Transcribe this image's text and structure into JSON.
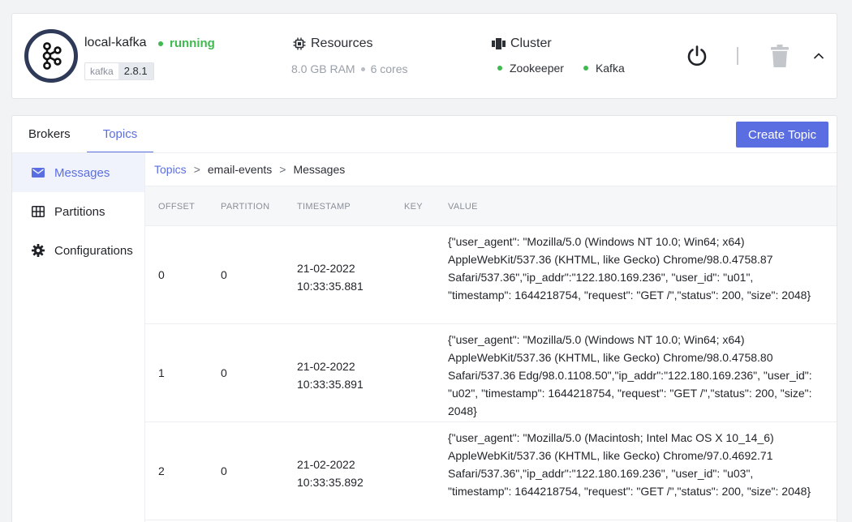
{
  "instance": {
    "name": "local-kafka",
    "status": "running",
    "tag_key": "kafka",
    "tag_value": "2.8.1",
    "status_color": "#3fb950"
  },
  "resources": {
    "title": "Resources",
    "ram": "8.0 GB RAM",
    "cores": "6 cores"
  },
  "cluster": {
    "title": "Cluster",
    "items": [
      "Zookeeper",
      "Kafka"
    ]
  },
  "tabs": [
    "Brokers",
    "Topics"
  ],
  "active_tab": "Topics",
  "create_button": "Create Topic",
  "accent_color": "#5b6ee1",
  "sidebar": [
    {
      "label": "Messages",
      "icon": "envelope-icon"
    },
    {
      "label": "Partitions",
      "icon": "grid-icon"
    },
    {
      "label": "Configurations",
      "icon": "gear-icon"
    }
  ],
  "breadcrumb": [
    "Topics",
    "email-events",
    "Messages"
  ],
  "columns": [
    "OFFSET",
    "PARTITION",
    "TIMESTAMP",
    "KEY",
    "VALUE"
  ],
  "rows": [
    {
      "offset": "0",
      "partition": "0",
      "timestamp": "21-02-2022 10:33:35.881",
      "key": "",
      "value": "{\"user_agent\": \"Mozilla/5.0 (Windows NT 10.0; Win64; x64) AppleWebKit/537.36 (KHTML, like Gecko) Chrome/98.0.4758.87 Safari/537.36\",\"ip_addr\":\"122.180.169.236\", \"user_id\": \"u01\", \"timestamp\": 1644218754, \"request\": \"GET /\",\"status\": 200, \"size\": 2048}"
    },
    {
      "offset": "1",
      "partition": "0",
      "timestamp": "21-02-2022 10:33:35.891",
      "key": "",
      "value": "{\"user_agent\": \"Mozilla/5.0 (Windows NT 10.0; Win64; x64) AppleWebKit/537.36 (KHTML, like Gecko) Chrome/98.0.4758.80 Safari/537.36 Edg/98.0.1108.50\",\"ip_addr\":\"122.180.169.236\", \"user_id\": \"u02\", \"timestamp\": 1644218754, \"request\": \"GET /\",\"status\": 200, \"size\": 2048}"
    },
    {
      "offset": "2",
      "partition": "0",
      "timestamp": "21-02-2022 10:33:35.892",
      "key": "",
      "value": "{\"user_agent\": \"Mozilla/5.0 (Macintosh; Intel Mac OS X 10_14_6) AppleWebKit/537.36 (KHTML, like Gecko) Chrome/97.0.4692.71 Safari/537.36\",\"ip_addr\":\"122.180.169.236\", \"user_id\": \"u03\", \"timestamp\": 1644218754, \"request\": \"GET /\",\"status\": 200, \"size\": 2048}"
    }
  ]
}
